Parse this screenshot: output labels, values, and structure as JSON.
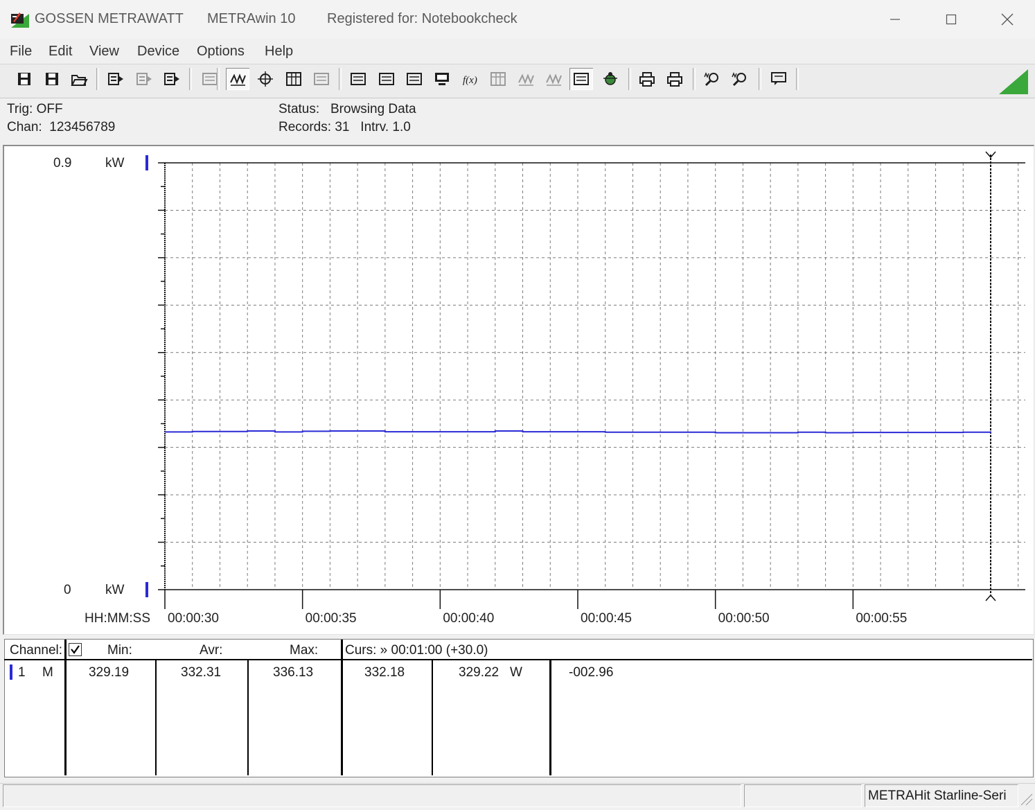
{
  "window": {
    "brand": "GOSSEN METRAWATT",
    "app_name": "METRAwin 10",
    "registration": "Registered for: Notebookcheck"
  },
  "menu": [
    "File",
    "Edit",
    "View",
    "Device",
    "Options",
    "Help"
  ],
  "toolbar_icons": [
    "save-icon",
    "save-as-icon",
    "open-icon",
    "record-icon",
    "record-disabled-icon",
    "stop-record-icon",
    "device-settings-icon",
    "yt-mode-icon",
    "xy-mode-icon",
    "table-view-icon",
    "bar-view-icon",
    "export-icon",
    "import-icon",
    "scale-icon",
    "monitor-icon",
    "formula-icon",
    "list-icon",
    "waveform-icon",
    "noise-icon",
    "copy-data-icon",
    "bug-icon",
    "print-icon",
    "print-preview-icon",
    "zoom-in-icon",
    "zoom-out-icon",
    "comment-icon"
  ],
  "status": {
    "trig_label": "Trig:",
    "trig_value": "OFF",
    "chan_label": "Chan:",
    "chan_value": "123456789",
    "status_label": "Status:",
    "status_value": "Browsing Data",
    "records_label": "Records:",
    "records_value": "31",
    "intrv_label": "Intrv.",
    "intrv_value": "1.0"
  },
  "chart_data": {
    "type": "line",
    "x_axis_label": "HH:MM:SS",
    "y_max_label": "0.9",
    "y_min_label": "0",
    "y_unit": "kW",
    "ylim": [
      0,
      0.9
    ],
    "x_ticks": [
      "00:00:30",
      "00:00:35",
      "00:00:40",
      "00:00:45",
      "00:00:50",
      "00:00:55"
    ],
    "x": [
      30,
      31,
      32,
      33,
      34,
      35,
      36,
      37,
      38,
      39,
      40,
      41,
      42,
      43,
      44,
      45,
      46,
      47,
      48,
      49,
      50,
      51,
      52,
      53,
      54,
      55,
      56,
      57,
      58,
      59,
      60
    ],
    "xlim": [
      30,
      60
    ],
    "series": [
      {
        "color": "#2a2ad6",
        "values": [
          0.3325,
          0.3335,
          0.3335,
          0.3345,
          0.3325,
          0.334,
          0.3345,
          0.3345,
          0.333,
          0.333,
          0.333,
          0.333,
          0.3345,
          0.333,
          0.333,
          0.333,
          0.332,
          0.332,
          0.332,
          0.332,
          0.331,
          0.331,
          0.331,
          0.332,
          0.331,
          0.3315,
          0.3315,
          0.3315,
          0.3315,
          0.332,
          0.3305
        ]
      }
    ],
    "grid": true,
    "cursor_x": 60
  },
  "table": {
    "headers": {
      "channel": "Channel:",
      "min": "Min:",
      "avr": "Avr:",
      "max": "Max:",
      "curs": "Curs: » 00:01:00 (+30.0)"
    },
    "rows": [
      {
        "channel": "1",
        "mode": "M",
        "min": "329.19",
        "avr": "332.31",
        "max": "336.13",
        "curs": "332.18",
        "value2": "329.22",
        "unit": "W",
        "delta": "-002.96"
      }
    ]
  },
  "statusbar": {
    "device": "METRAHit Starline-Seri"
  }
}
